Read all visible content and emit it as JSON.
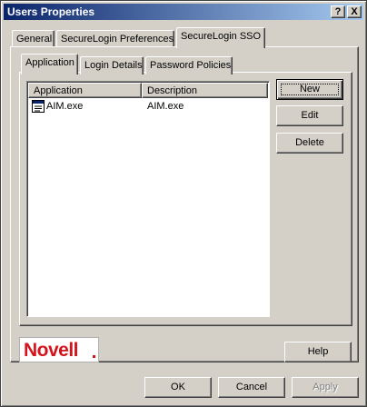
{
  "window": {
    "title": "Users Properties",
    "help_button": "?",
    "close_button": "X"
  },
  "outer_tabs": [
    {
      "label": "General",
      "active": false
    },
    {
      "label": "SecureLogin Preferences",
      "active": false
    },
    {
      "label": "SecureLogin SSO",
      "active": true
    }
  ],
  "inner_tabs": [
    {
      "label": "Application",
      "active": true
    },
    {
      "label": "Login Details",
      "active": false
    },
    {
      "label": "Password Policies",
      "active": false
    }
  ],
  "list": {
    "columns": [
      "Application",
      "Description"
    ],
    "rows": [
      {
        "application": "AIM.exe",
        "description": "AIM.exe",
        "icon": "application-icon"
      }
    ]
  },
  "side_buttons": {
    "new": "New",
    "edit": "Edit",
    "delete": "Delete"
  },
  "logo": "Novell",
  "help_label": "Help",
  "footer": {
    "ok": "OK",
    "cancel": "Cancel",
    "apply": "Apply"
  },
  "colors": {
    "title_start": "#0a246a",
    "title_end": "#a6caf0",
    "face": "#d4d0c8",
    "logo_red": "#d4141c"
  }
}
